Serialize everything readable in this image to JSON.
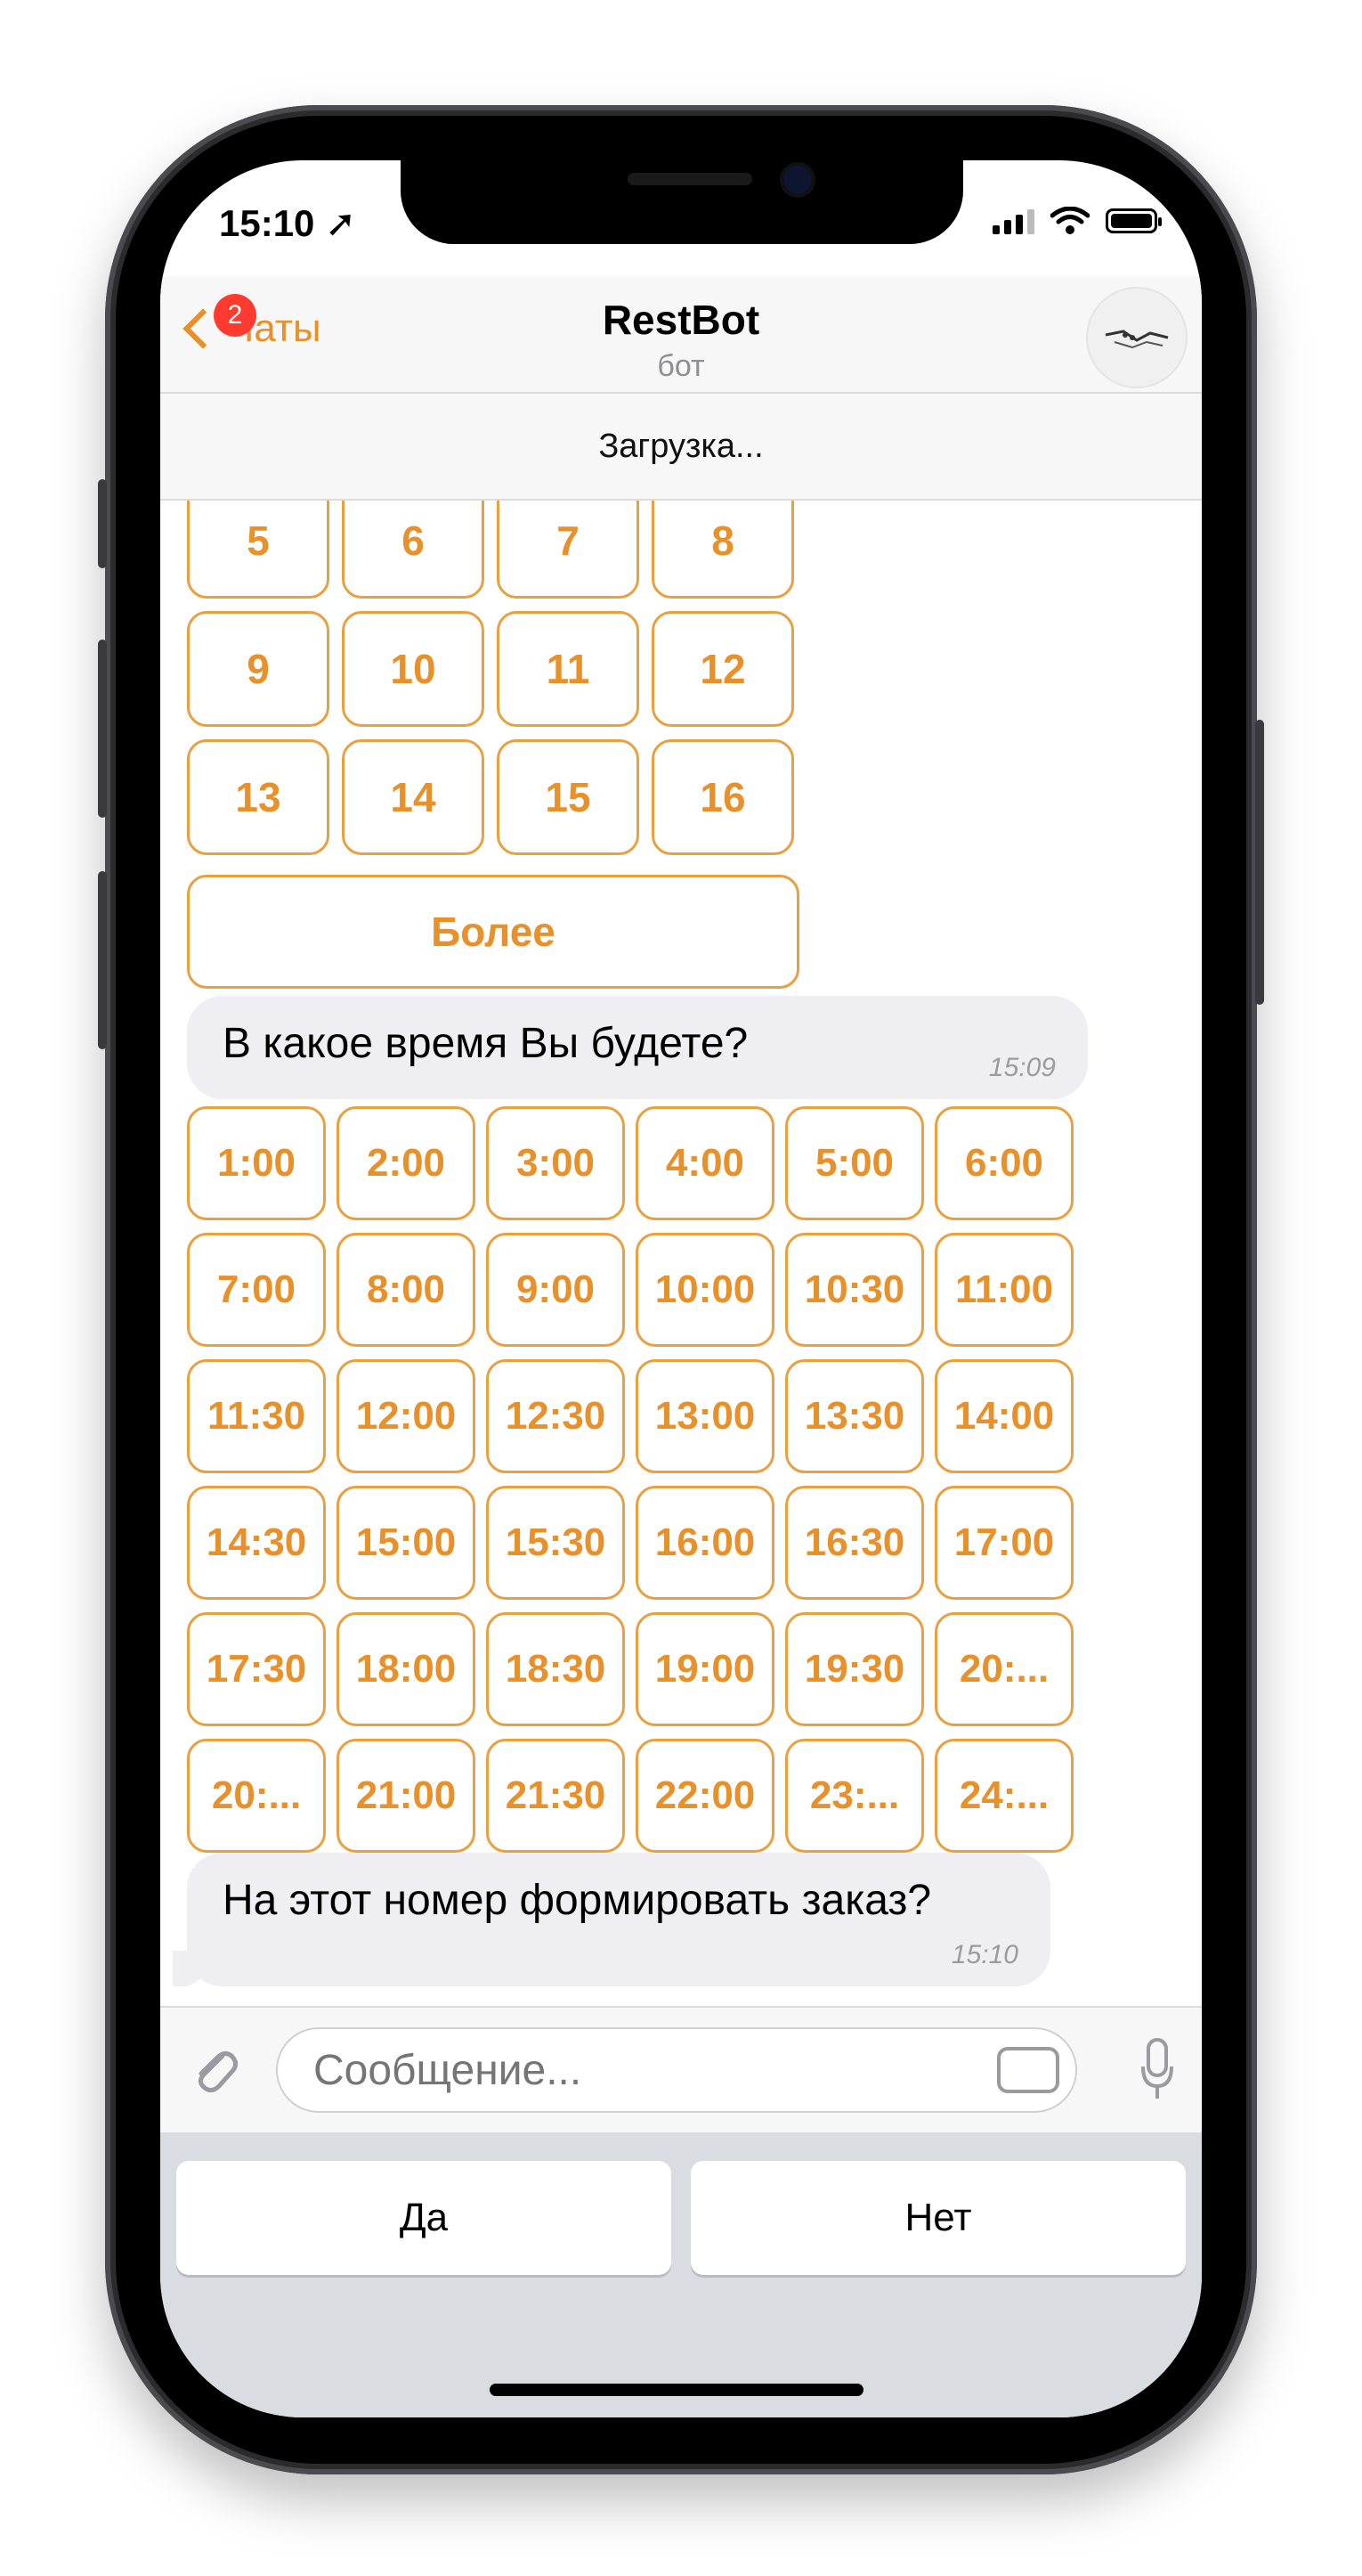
{
  "status": {
    "time": "15:10"
  },
  "navbar": {
    "back_label": "Чаты",
    "badge": "2",
    "title": "RestBot",
    "subtitle": "бот"
  },
  "loading_text": "Загрузка...",
  "number_keyboard": [
    "5",
    "6",
    "7",
    "8",
    "9",
    "10",
    "11",
    "12",
    "13",
    "14",
    "15",
    "16"
  ],
  "more_label": "Более",
  "message1": {
    "text": "В какое время Вы будете?",
    "time": "15:09"
  },
  "time_keyboard": [
    "1:00",
    "2:00",
    "3:00",
    "4:00",
    "5:00",
    "6:00",
    "7:00",
    "8:00",
    "9:00",
    "10:00",
    "10:30",
    "11:00",
    "11:30",
    "12:00",
    "12:30",
    "13:00",
    "13:30",
    "14:00",
    "14:30",
    "15:00",
    "15:30",
    "16:00",
    "16:30",
    "17:00",
    "17:30",
    "18:00",
    "18:30",
    "19:00",
    "19:30",
    "20:...",
    "20:...",
    "21:00",
    "21:30",
    "22:00",
    "23:...",
    "24:..."
  ],
  "message2": {
    "text": "На этот номер формировать заказ?",
    "time": "15:10"
  },
  "composer": {
    "placeholder": "Сообщение..."
  },
  "reply_buttons": {
    "yes": "Да",
    "no": "Нет"
  },
  "colors": {
    "accent": "#e8902a",
    "badge": "#ff3b30",
    "bubble": "#eeeef3"
  }
}
